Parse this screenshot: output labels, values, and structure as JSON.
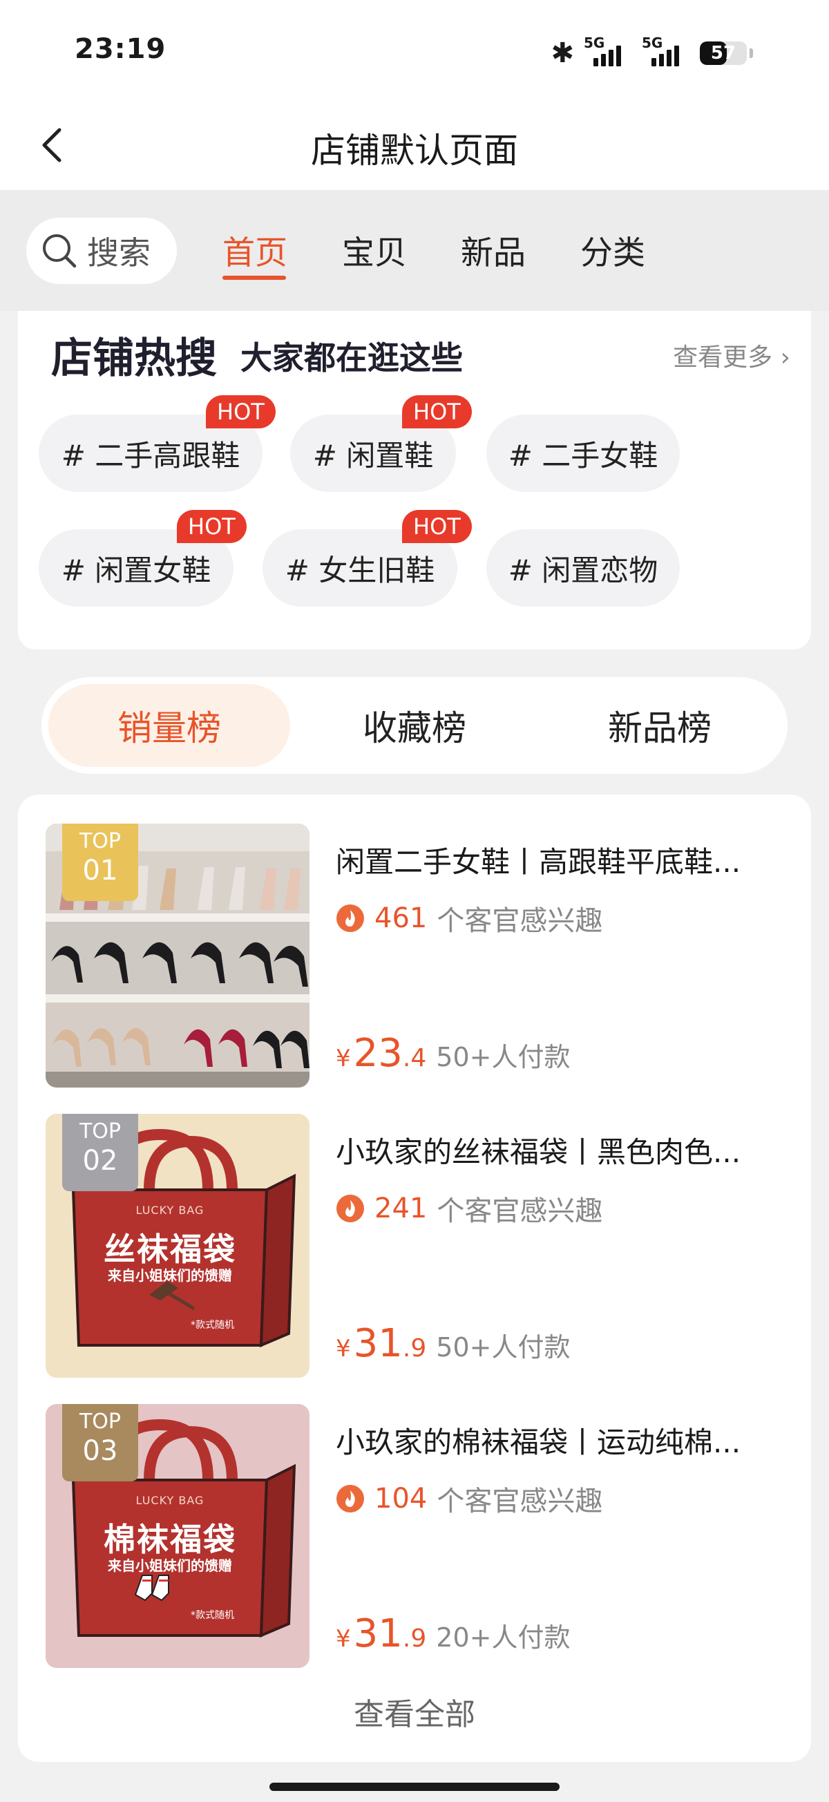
{
  "status_bar": {
    "time": "23:19",
    "network1": "5G",
    "network2": "5G",
    "battery": "57"
  },
  "nav": {
    "title": "店铺默认页面"
  },
  "tabs": {
    "search_label": "搜索",
    "items": [
      {
        "label": "首页",
        "active": true
      },
      {
        "label": "宝贝",
        "active": false
      },
      {
        "label": "新品",
        "active": false
      },
      {
        "label": "分类",
        "active": false
      }
    ]
  },
  "hot_search": {
    "title": "店铺热搜",
    "subtitle": "大家都在逛这些",
    "more": "查看更多",
    "badge": "HOT",
    "tags": [
      {
        "label": "# 二手高跟鞋",
        "hot": true
      },
      {
        "label": "# 闲置鞋",
        "hot": true
      },
      {
        "label": "# 二手女鞋",
        "hot": false
      },
      {
        "label": "# 闲置女鞋",
        "hot": true
      },
      {
        "label": "# 女生旧鞋",
        "hot": true
      },
      {
        "label": "# 闲置恋物",
        "hot": false
      }
    ]
  },
  "rank_tabs": [
    {
      "label": "销量榜",
      "active": true
    },
    {
      "label": "收藏榜",
      "active": false
    },
    {
      "label": "新品榜",
      "active": false
    }
  ],
  "products": [
    {
      "rank_label": "TOP",
      "rank": "01",
      "title": "闲置二手女鞋丨高跟鞋平底鞋...",
      "interest_count": "461",
      "interest_text": "个客官感兴趣",
      "currency": "¥",
      "price_int": "23",
      "price_dec": ".4",
      "sold": "50+人付款"
    },
    {
      "rank_label": "TOP",
      "rank": "02",
      "title": "小玖家的丝袜福袋丨黑色肉色...",
      "interest_count": "241",
      "interest_text": "个客官感兴趣",
      "currency": "¥",
      "price_int": "31",
      "price_dec": ".9",
      "sold": "50+人付款",
      "bag_title": "丝袜福袋",
      "bag_top": "LUCKY BAG",
      "bag_sub": "来自小姐妹们的馈赠",
      "bag_note": "*款式随机"
    },
    {
      "rank_label": "TOP",
      "rank": "03",
      "title": "小玖家的棉袜福袋丨运动纯棉...",
      "interest_count": "104",
      "interest_text": "个客官感兴趣",
      "currency": "¥",
      "price_int": "31",
      "price_dec": ".9",
      "sold": "20+人付款",
      "bag_title": "棉袜福袋",
      "bag_top": "LUCKY BAG",
      "bag_sub": "来自小姐妹们的馈赠",
      "bag_note": "*款式随机"
    }
  ],
  "see_all": "查看全部",
  "colors": {
    "accent": "#e8542a",
    "hot_badge": "#e83a2a",
    "top1": "#e9c35a",
    "top2": "#a3a3a8",
    "top3": "#a88a5e",
    "bag_red": "#b3322e"
  }
}
